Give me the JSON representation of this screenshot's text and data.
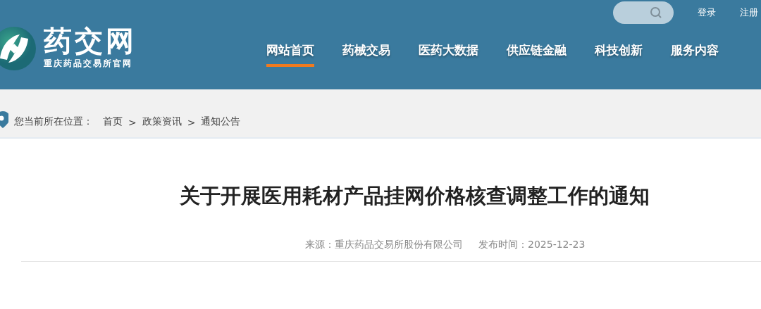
{
  "header": {
    "brand": "药交网",
    "subtitle": "重庆药品交易所官网",
    "links": [
      {
        "label": "登录"
      },
      {
        "label": "注册"
      }
    ],
    "nav": [
      {
        "label": "网站首页",
        "selected": true
      },
      {
        "label": "药械交易",
        "selected": false
      },
      {
        "label": "医药大数据",
        "selected": false
      },
      {
        "label": "供应链金融",
        "selected": false
      },
      {
        "label": "科技创新",
        "selected": false
      },
      {
        "label": "服务内容",
        "selected": false
      }
    ]
  },
  "breadcrumb": {
    "prefix": "您当前所在位置：",
    "items": [
      "首页",
      "政策资讯",
      "通知公告"
    ],
    "separator": ">"
  },
  "article": {
    "title": "关于开展医用耗材产品挂网价格核查调整工作的通知",
    "source": "来源：重庆药品交易所股份有限公司",
    "date": "发布时间：2025-12-23"
  }
}
